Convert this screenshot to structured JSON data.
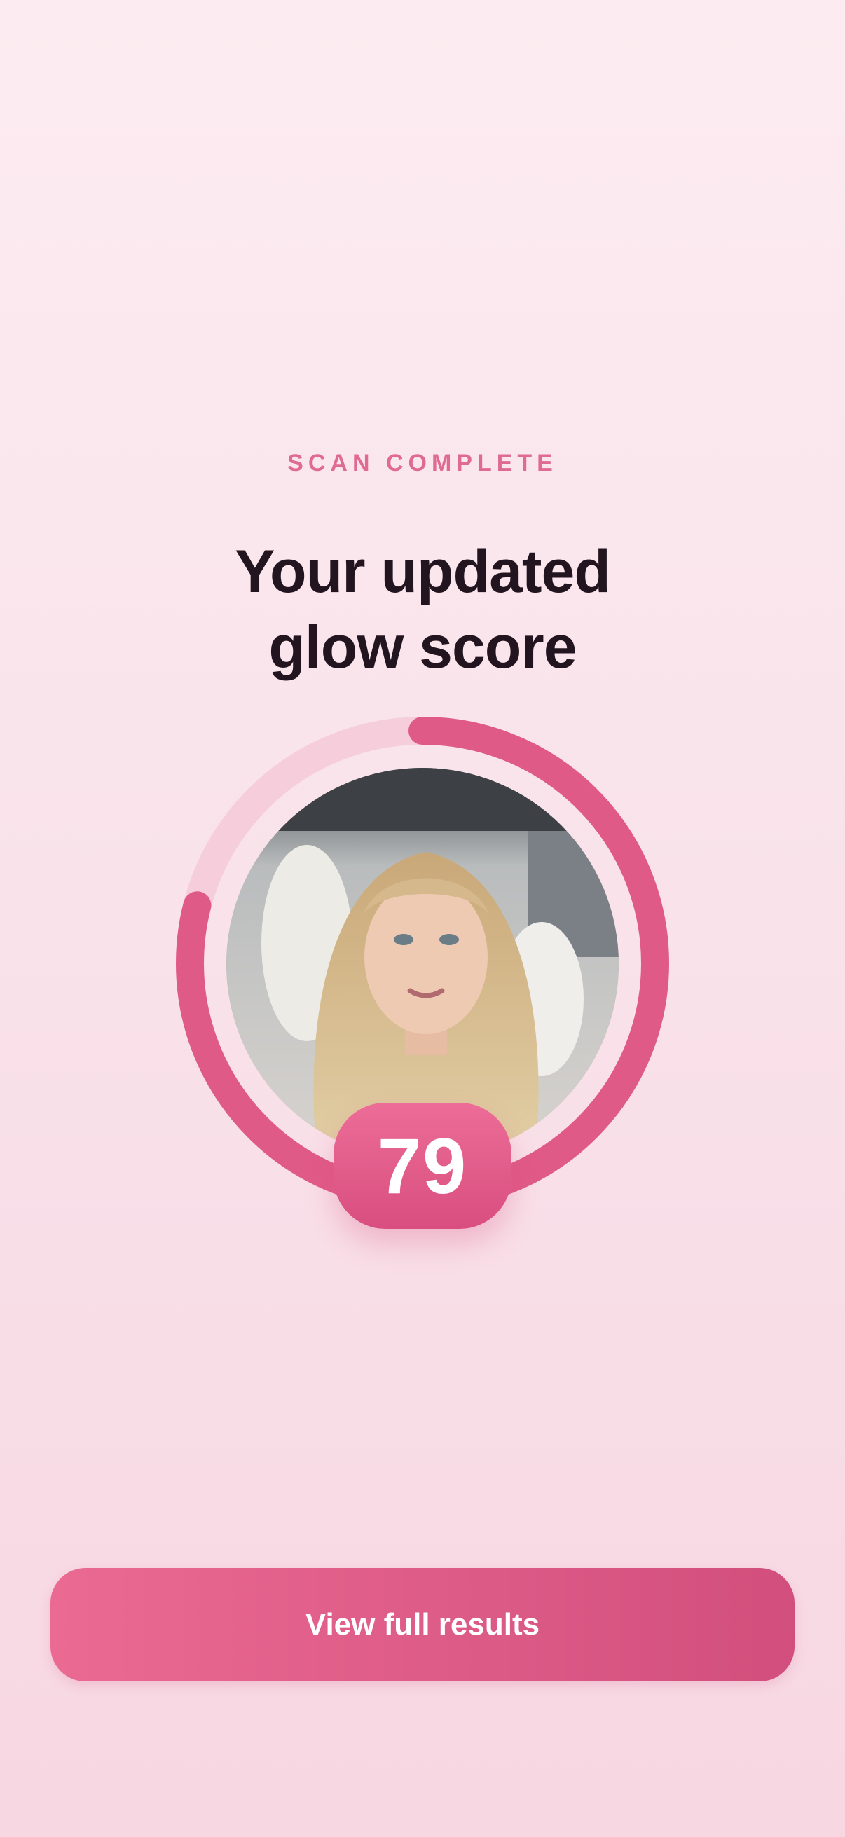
{
  "header": {
    "eyebrow": "SCAN COMPLETE",
    "title_line1": "Your updated",
    "title_line2": "glow score"
  },
  "score": {
    "value": "79",
    "fraction": 0.79,
    "progress_color": "#e05a88",
    "track_color": "#f6cddb"
  },
  "photo": {
    "icon": "user-selfie-photo"
  },
  "cta": {
    "label": "View full results"
  },
  "colors": {
    "accent": "#e06b92",
    "button_start": "#ea6a93",
    "button_end": "#d24f7d",
    "text_dark": "#231520"
  }
}
